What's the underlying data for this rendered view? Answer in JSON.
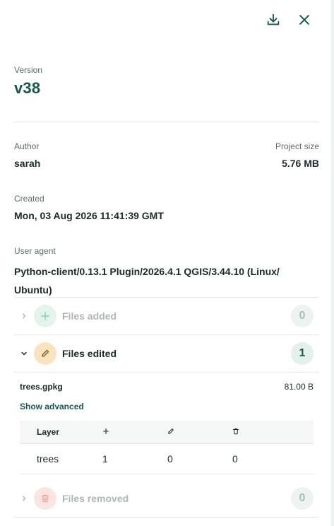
{
  "header": {
    "download_icon": "download-icon",
    "close_icon": "close-icon"
  },
  "version": {
    "label": "Version",
    "value": "v38"
  },
  "author": {
    "label": "Author",
    "value": "sarah"
  },
  "project_size": {
    "label": "Project size",
    "value": "5.76 MB"
  },
  "created": {
    "label": "Created",
    "value": "Mon, 03 Aug 2026 11:41:39 GMT"
  },
  "user_agent": {
    "label": "User agent",
    "value": "Python-client/0.13.1 Plugin/2026.4.1 QGIS/3.44.10 (Linux/ Ubuntu)"
  },
  "sections": {
    "added": {
      "label": "Files added",
      "count": "0",
      "icon": "plus-icon",
      "color": "#e3f4ea"
    },
    "edited": {
      "label": "Files edited",
      "count": "1",
      "icon": "pencil-icon",
      "color": "#fbe3c0"
    },
    "removed": {
      "label": "Files removed",
      "count": "0",
      "icon": "trash-icon",
      "color": "#fbe4e1"
    }
  },
  "edited_file": {
    "name": "trees.gpkg",
    "size": "81.00 B",
    "advanced_link": "Show advanced",
    "table": {
      "header_layer": "Layer",
      "rows": [
        {
          "layer": "trees",
          "added": "1",
          "edited": "0",
          "removed": "0"
        }
      ]
    }
  },
  "colors": {
    "accent": "#14584f",
    "divider": "#e3e8e8"
  }
}
